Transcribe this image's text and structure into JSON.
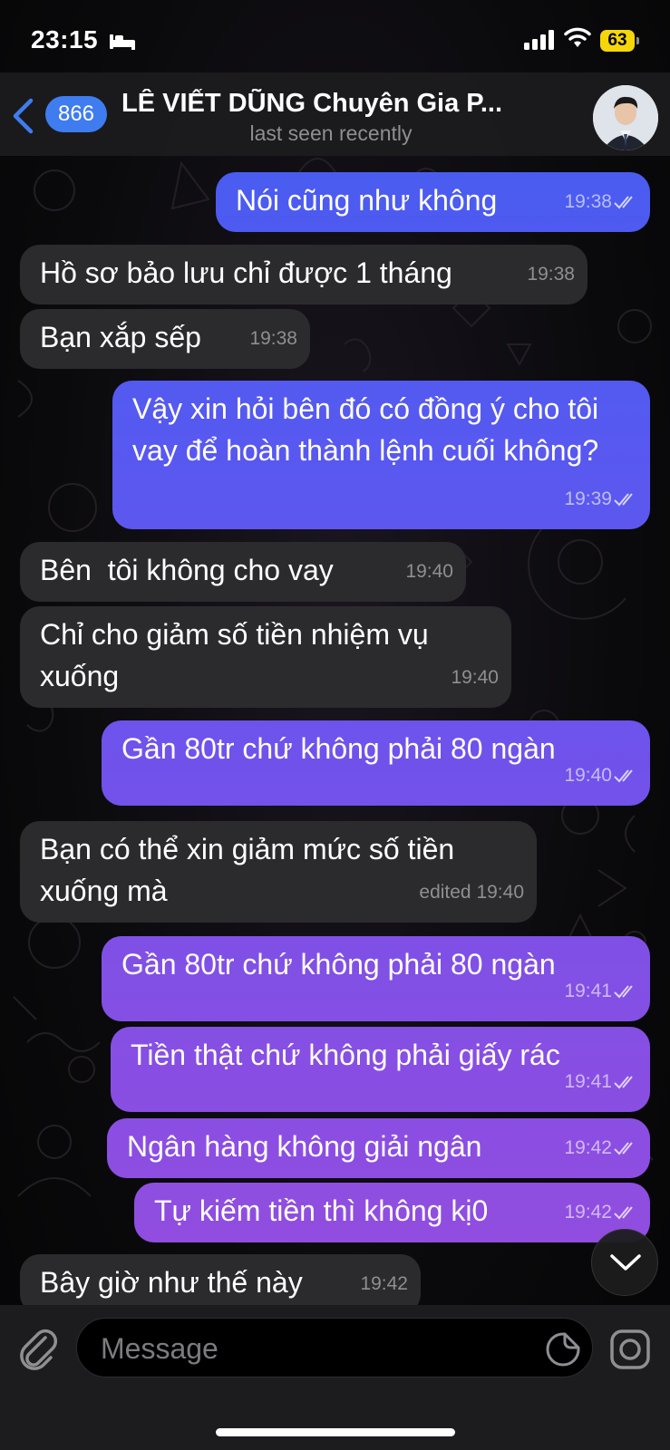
{
  "status_bar": {
    "time": "23:15",
    "battery": "63"
  },
  "header": {
    "unread_count": "866",
    "contact_name": "LÊ VIẾT DŨNG Chuyên Gia P...",
    "contact_status": "last seen recently"
  },
  "messages": [
    {
      "direction": "out",
      "text": "Nói cũng như không",
      "time": "19:38",
      "read": true
    },
    {
      "direction": "in",
      "text": "Hồ sơ bảo lưu chỉ được 1 tháng",
      "time": "19:38"
    },
    {
      "direction": "in",
      "text": "Bạn xắp sếp",
      "time": "19:38"
    },
    {
      "direction": "out",
      "text": "Vậy xin hỏi bên đó có đồng ý cho tôi vay để hoàn thành lệnh cuối không?",
      "time": "19:39",
      "read": true
    },
    {
      "direction": "in",
      "text": "Bên  tôi không cho vay",
      "time": "19:40"
    },
    {
      "direction": "in",
      "text": "Chỉ cho giảm số tiền nhiệm vụ xuống",
      "time": "19:40"
    },
    {
      "direction": "out",
      "text": "Gần 80tr chứ không phải 80 ngàn",
      "time": "19:40",
      "read": true
    },
    {
      "direction": "in",
      "text": "Bạn có thể xin giảm mức số tiền xuống mà",
      "time": "edited 19:40"
    },
    {
      "direction": "out",
      "text": "Gần 80tr chứ không phải 80 ngàn",
      "time": "19:41",
      "read": true
    },
    {
      "direction": "out",
      "text": "Tiền thật chứ không phải giấy rác",
      "time": "19:41",
      "read": true
    },
    {
      "direction": "out",
      "text": "Ngân hàng không giải ngân",
      "time": "19:42",
      "read": true
    },
    {
      "direction": "out",
      "text": "Tự kiếm tiền thì không kị0",
      "time": "19:42",
      "read": true
    },
    {
      "direction": "in",
      "text": "Bây giờ như thế này",
      "time": "19:42"
    }
  ],
  "input": {
    "placeholder": "Message"
  },
  "icons": {
    "back": "chevron-left-icon",
    "attach": "paperclip-icon",
    "sticker": "sticker-icon",
    "camera": "camera-icon",
    "scroll_down": "chevron-down-icon",
    "sleep": "bed-icon",
    "signal": "signal-icon",
    "wifi": "wifi-icon"
  },
  "colors": {
    "accent": "#3f7cf0",
    "incoming_bubble": "#2b2b2e",
    "outgoing_gradient_top": "#4a5cf0",
    "outgoing_gradient_bottom": "#8c4fe0",
    "battery": "#f5d60a"
  }
}
